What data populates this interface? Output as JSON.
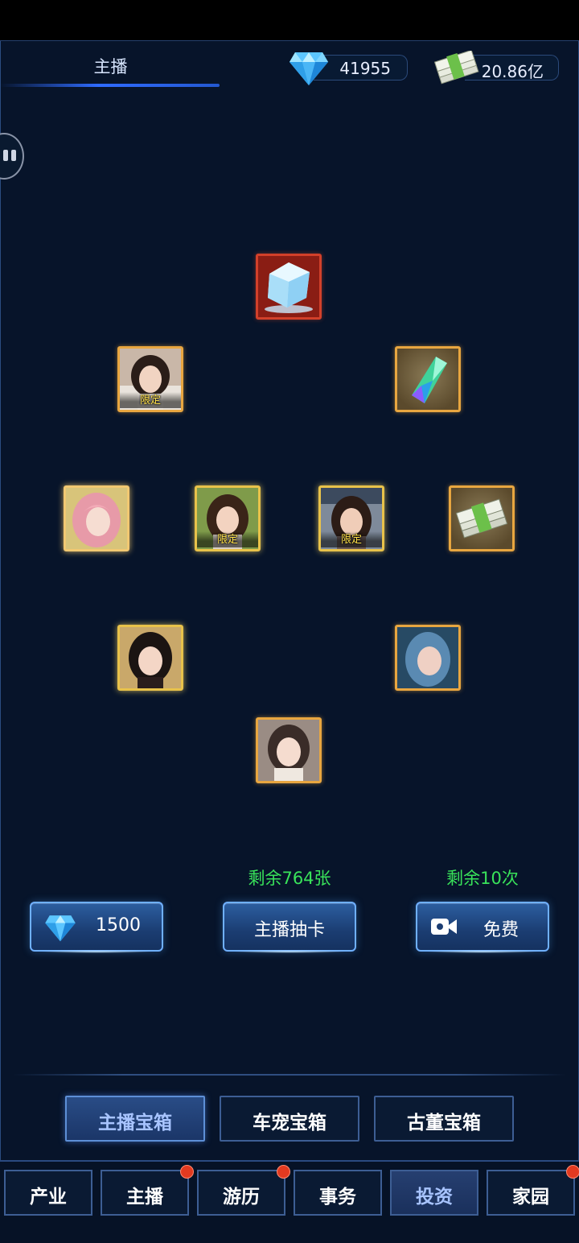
{
  "header": {
    "title": "主播",
    "diamonds": "41955",
    "cash": "20.86亿"
  },
  "prizes": [
    {
      "name": "冰块",
      "icon": "ice-cube-icon",
      "frame": "red"
    },
    {
      "name": "主播",
      "tag": "限定",
      "frame": "gold"
    },
    {
      "name": "水晶",
      "icon": "crystal-shard-icon",
      "frame": "gold"
    },
    {
      "name": "主播",
      "frame": "pinkglow"
    },
    {
      "name": "主播",
      "tag": "限定",
      "frame": "yellow"
    },
    {
      "name": "主播",
      "tag": "限定",
      "frame": "yellow"
    },
    {
      "name": "钞票",
      "icon": "cash-stack-icon",
      "frame": "gold"
    },
    {
      "name": "主播",
      "frame": "yellow"
    },
    {
      "name": "主播",
      "frame": "gold"
    },
    {
      "name": "主播",
      "frame": "gold"
    }
  ],
  "draw": {
    "remaining_cards": "剩余764张",
    "remaining_times": "剩余10次",
    "diamond_cost": "1500",
    "draw_label": "主播抽卡",
    "free_label": "免费"
  },
  "box_tabs": [
    "主播宝箱",
    "车宠宝箱",
    "古董宝箱"
  ],
  "nav": [
    "产业",
    "主播",
    "游历",
    "事务",
    "投资",
    "家园"
  ],
  "colors": {
    "background": "#07142a",
    "accent": "#6fb0ff",
    "remaining_text": "#39e35a",
    "limited_tag": "#ffe04a",
    "notification": "#e23a20"
  }
}
